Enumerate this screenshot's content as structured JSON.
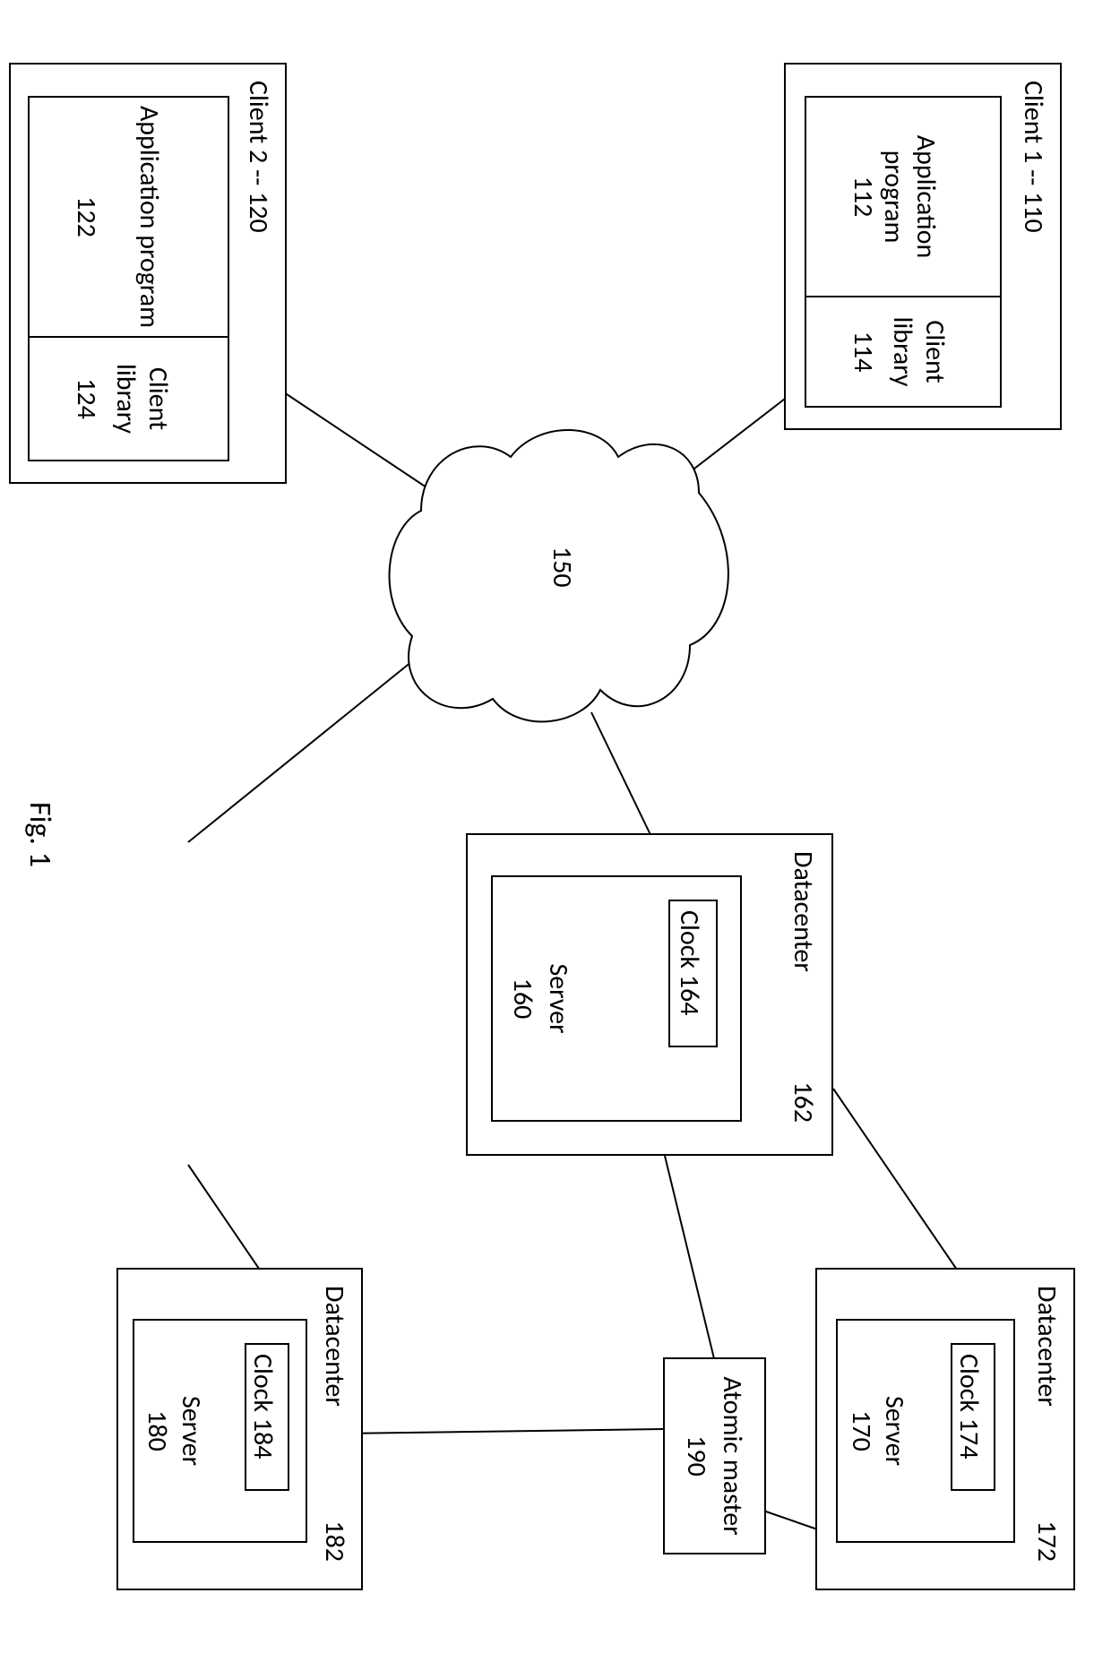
{
  "figure_caption": "Fig. 1",
  "client1": {
    "title": "Client 1 -- 110",
    "app_label": "Application program",
    "app_ref": "112",
    "lib_label": "Client library",
    "lib_ref": "114"
  },
  "client2": {
    "title": "Client 2 -- 120",
    "app_label": "Application program",
    "app_ref": "122",
    "lib_label": "Client library",
    "lib_ref": "124"
  },
  "cloud_ref": "150",
  "dc_center": {
    "title": "Datacenter",
    "title_ref": "162",
    "server_label": "Server",
    "server_ref": "160",
    "clock_label": "Clock",
    "clock_ref": "164"
  },
  "dc_top": {
    "title": "Datacenter",
    "title_ref": "172",
    "server_label": "Server",
    "server_ref": "170",
    "clock_label": "Clock",
    "clock_ref": "174"
  },
  "dc_bottom": {
    "title": "Datacenter",
    "title_ref": "182",
    "server_label": "Server",
    "server_ref": "180",
    "clock_label": "Clock",
    "clock_ref": "184"
  },
  "atomic": {
    "label": "Atomic master",
    "ref": "190"
  }
}
